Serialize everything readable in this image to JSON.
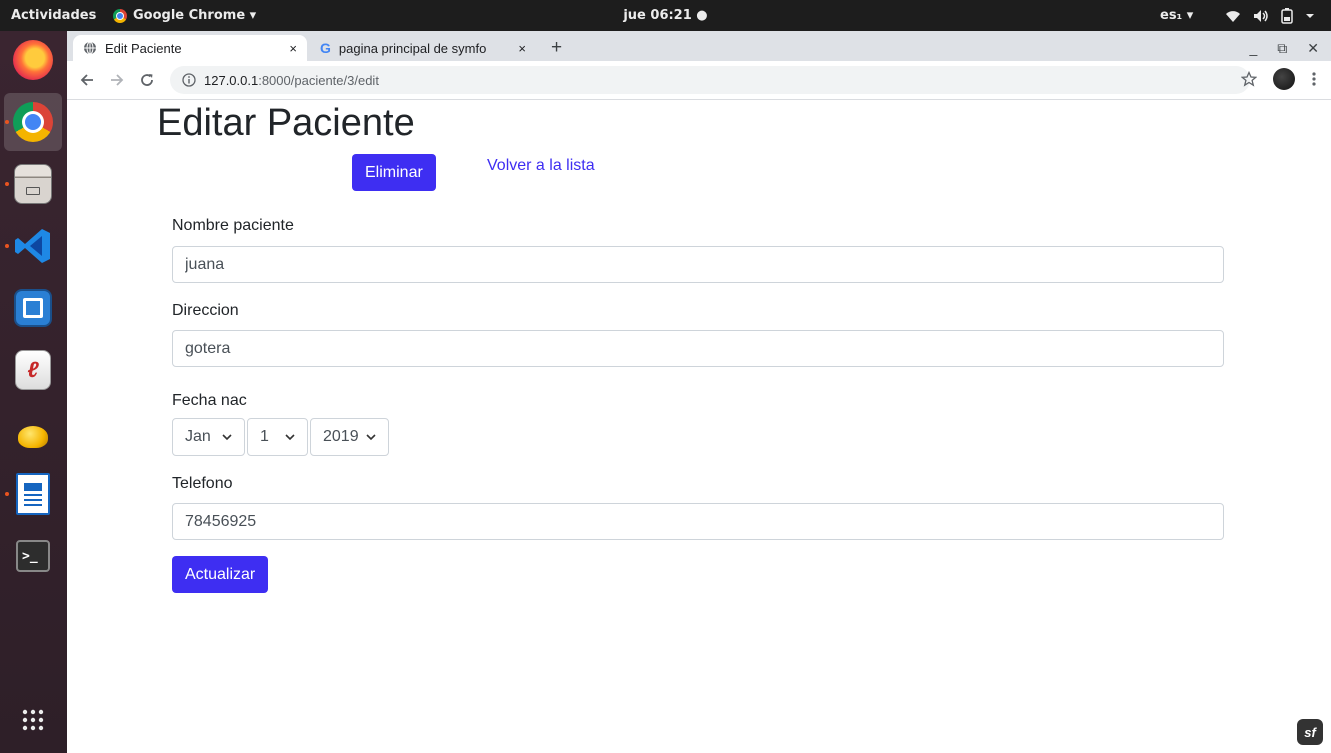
{
  "topbar": {
    "activities": "Actividades",
    "app_name": "Google Chrome ▾",
    "clock": "jue 06:21 ●",
    "language": "es₁ ▾",
    "status_icons": [
      "wifi-icon",
      "volume-icon",
      "battery-icon",
      "chevron-down-icon"
    ]
  },
  "dock": {
    "apps": [
      "firefox-icon",
      "chrome-icon",
      "files-icon",
      "vscode-icon",
      "boxes-icon",
      "evince-icon",
      "teapot-icon",
      "writer-icon",
      "terminal-icon"
    ],
    "show_apps_icon": "apps-grid-icon"
  },
  "browser": {
    "tabs": [
      {
        "title": "Edit Paciente",
        "icon": "globe-icon"
      },
      {
        "title": "pagina principal de symfo",
        "icon": "google-icon"
      }
    ],
    "tab_close": "×",
    "new_tab": "+",
    "url_host": "127.0.0.1",
    "url_rest": ":8000/paciente/3/edit",
    "window_controls": {
      "minimize": "_",
      "restore": "⧉",
      "close": "✕"
    }
  },
  "form": {
    "page_title": "Editar Paciente",
    "delete_label": "Eliminar",
    "back_link": "Volver a la lista",
    "nombre_label": "Nombre paciente",
    "nombre_value": "juana",
    "direccion_label": "Direccion",
    "direccion_value": "gotera",
    "fecha_label": "Fecha nac",
    "fecha_month": "Jan",
    "fecha_day": "1",
    "fecha_year": "2019",
    "telefono_label": "Telefono",
    "telefono_value": "78456925",
    "submit_label": "Actualizar"
  },
  "colors": {
    "primary": "#3e2ef2",
    "dock_bg": "#3a2530",
    "topbar_bg": "#1d1d1d",
    "accent": "#e95420"
  }
}
